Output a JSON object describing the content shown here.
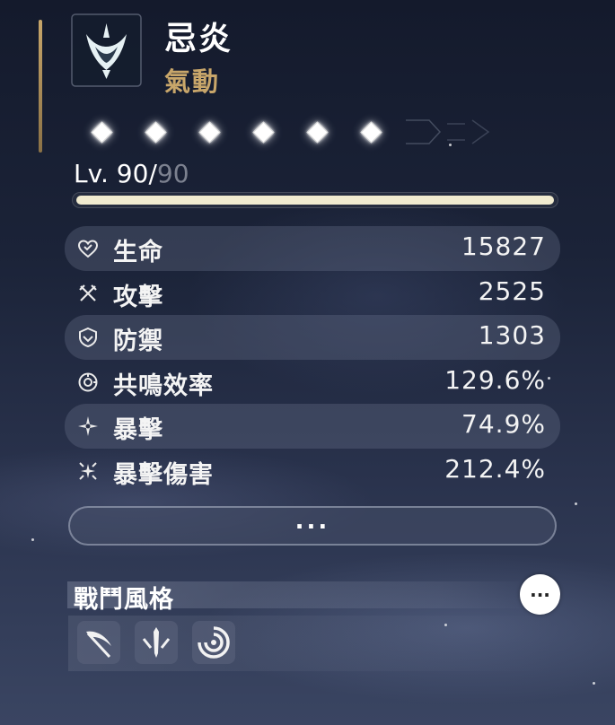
{
  "character": {
    "name": "忌炎",
    "attribute": "氣動",
    "sequence_nodes": 6,
    "level": "90",
    "max_level": "90",
    "level_progress": 1.0
  },
  "stats": [
    {
      "label": "生命",
      "value": "15827",
      "icon": "heart-icon"
    },
    {
      "label": "攻擊",
      "value": "2525",
      "icon": "crossed-swords-icon"
    },
    {
      "label": "防禦",
      "value": "1303",
      "icon": "shield-icon"
    },
    {
      "label": "共鳴效率",
      "value": "129.6%",
      "icon": "resonance-icon"
    },
    {
      "label": "暴擊",
      "value": "74.9%",
      "icon": "crit-star-icon"
    },
    {
      "label": "暴擊傷害",
      "value": "212.4%",
      "icon": "crit-burst-icon"
    }
  ],
  "more_button": "...",
  "combat_style": {
    "title": "戰鬥風格",
    "more_label": "···",
    "icons": [
      "scythe-icon",
      "sword-icon",
      "whirlwind-icon"
    ]
  },
  "colors": {
    "accent_gold": "#c8a66a",
    "level_bar": "#f1ebcf"
  }
}
